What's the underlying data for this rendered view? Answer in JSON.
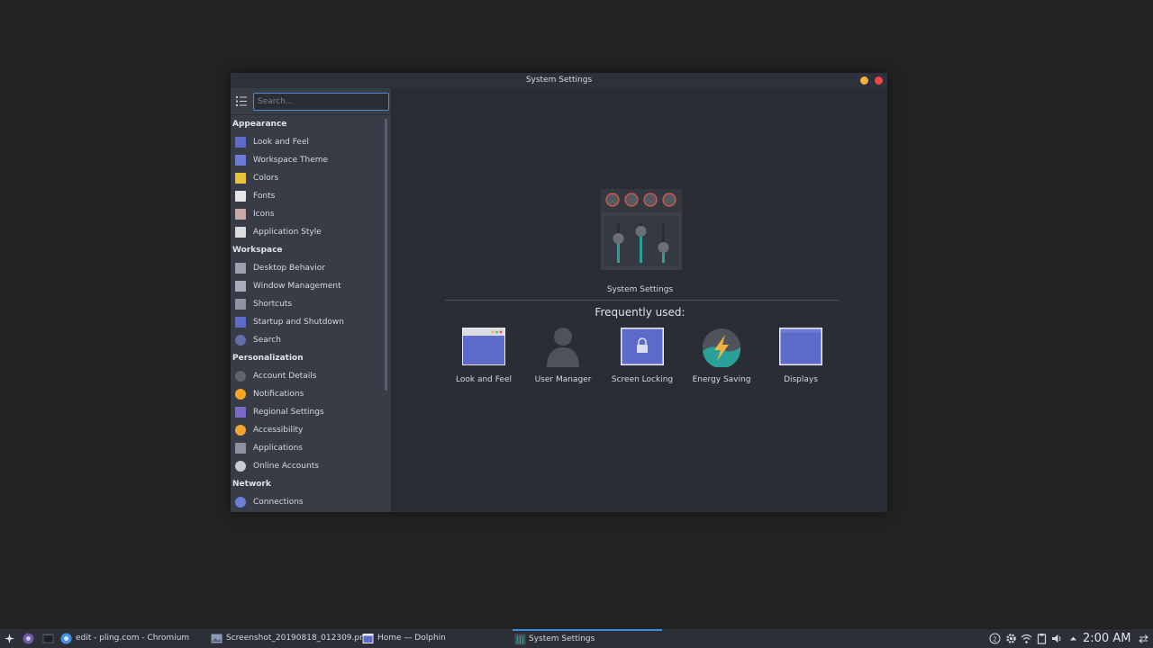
{
  "window": {
    "title": "System Settings"
  },
  "sidebar": {
    "search_placeholder": "Search...",
    "categories": [
      {
        "label": "Appearance",
        "items": [
          {
            "label": "Look and Feel",
            "icon": "look-and-feel-icon",
            "color": "#5d6ac9"
          },
          {
            "label": "Workspace Theme",
            "icon": "workspace-theme-icon",
            "color": "#6c7ad8"
          },
          {
            "label": "Colors",
            "icon": "colors-icon",
            "color": "#e8c23b"
          },
          {
            "label": "Fonts",
            "icon": "fonts-icon",
            "color": "#e6e6e6"
          },
          {
            "label": "Icons",
            "icon": "icons-icon",
            "color": "#c9a8a8"
          },
          {
            "label": "Application Style",
            "icon": "application-style-icon",
            "color": "#dcdcdc"
          }
        ]
      },
      {
        "label": "Workspace",
        "items": [
          {
            "label": "Desktop Behavior",
            "icon": "desktop-behavior-icon",
            "color": "#9aa0ad"
          },
          {
            "label": "Window Management",
            "icon": "window-management-icon",
            "color": "#a7adb8"
          },
          {
            "label": "Shortcuts",
            "icon": "shortcuts-icon",
            "color": "#8f95a0"
          },
          {
            "label": "Startup and Shutdown",
            "icon": "startup-shutdown-icon",
            "color": "#5d6ac9"
          },
          {
            "label": "Search",
            "icon": "search-icon",
            "color": "#5f6ea8"
          }
        ]
      },
      {
        "label": "Personalization",
        "items": [
          {
            "label": "Account Details",
            "icon": "account-details-icon",
            "color": "#5f636c"
          },
          {
            "label": "Notifications",
            "icon": "notifications-icon",
            "color": "#f5a623"
          },
          {
            "label": "Regional Settings",
            "icon": "regional-settings-icon",
            "color": "#7b68c9"
          },
          {
            "label": "Accessibility",
            "icon": "accessibility-icon",
            "color": "#f0a530"
          },
          {
            "label": "Applications",
            "icon": "applications-icon",
            "color": "#8c92a0"
          },
          {
            "label": "Online Accounts",
            "icon": "online-accounts-icon",
            "color": "#c8ccd4"
          }
        ]
      },
      {
        "label": "Network",
        "items": [
          {
            "label": "Connections",
            "icon": "connections-icon",
            "color": "#6b7fd6"
          }
        ]
      }
    ]
  },
  "main": {
    "hero_caption": "System Settings",
    "frequently_used_title": "Frequently used:",
    "tiles": [
      {
        "label": "Look and Feel",
        "icon": "look-and-feel-icon"
      },
      {
        "label": "User Manager",
        "icon": "user-manager-icon"
      },
      {
        "label": "Screen Locking",
        "icon": "screen-locking-icon"
      },
      {
        "label": "Energy Saving",
        "icon": "energy-saving-icon"
      },
      {
        "label": "Displays",
        "icon": "displays-icon"
      }
    ]
  },
  "taskbar": {
    "tasks": [
      {
        "label": "edit - pling.com - Chromium",
        "icon": "chromium-icon"
      },
      {
        "label": "Screenshot_20190818_012309.pn...",
        "icon": "image-file-icon"
      },
      {
        "label": "Home — Dolphin",
        "icon": "dolphin-icon"
      },
      {
        "label": "System Settings",
        "icon": "system-settings-icon",
        "active": true
      }
    ],
    "clock": "2:00 AM"
  },
  "colors": {
    "accent": "#3d8fe0",
    "window_bg": "#2a2d36",
    "sidebar_bg": "#383c47"
  }
}
